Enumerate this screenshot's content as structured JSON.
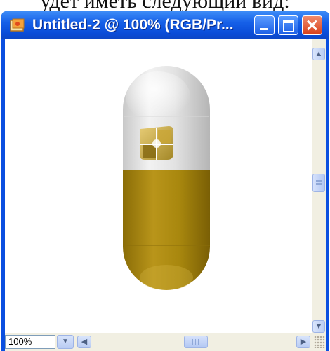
{
  "page_text": "удет иметь следующий вид:",
  "window": {
    "title": "Untitled-2 @ 100% (RGB/Pr...",
    "app_icon": "photoshop-document-icon",
    "buttons": [
      "minimize-icon",
      "maximize-icon",
      "close-icon"
    ]
  },
  "canvas": {
    "content": "pill capsule illustration",
    "colors": {
      "top": "#e0e0e0",
      "bottom": "#a8870e",
      "highlight": "#ffffff",
      "logo": "#c9a227"
    }
  },
  "statusbar": {
    "zoom": "100%",
    "icons": [
      "chevron-down-icon",
      "scroll-left-icon",
      "scroll-right-icon"
    ]
  },
  "scrollbars": {
    "vertical": {
      "icons": [
        "scroll-up-icon",
        "scroll-down-icon"
      ]
    }
  }
}
